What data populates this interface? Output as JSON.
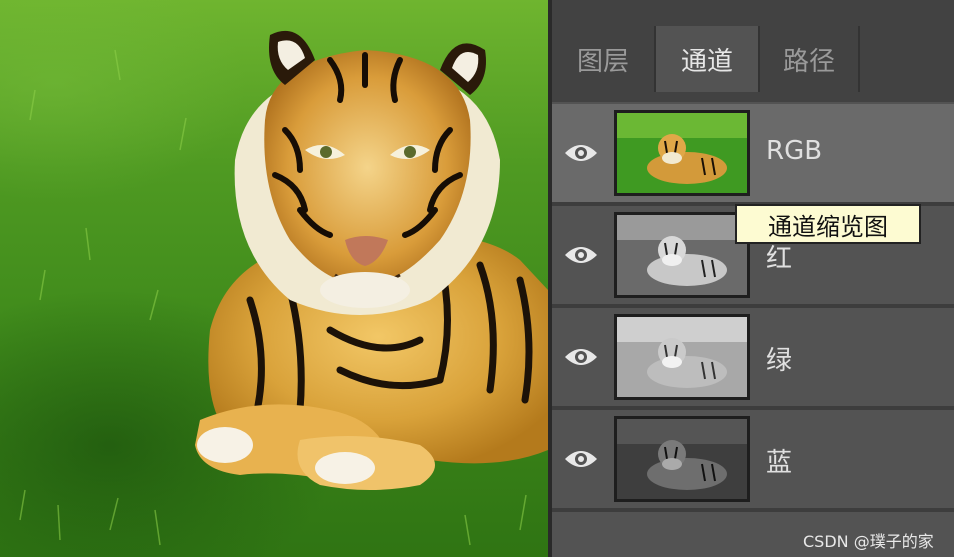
{
  "panel": {
    "tabs": [
      {
        "label": "图层",
        "active": false
      },
      {
        "label": "通道",
        "active": true
      },
      {
        "label": "路径",
        "active": false
      }
    ],
    "channels": [
      {
        "label": "RGB",
        "thumb": "color",
        "selected": true
      },
      {
        "label": "红",
        "thumb": "gray-dark",
        "selected": false
      },
      {
        "label": "绿",
        "thumb": "gray-light",
        "selected": false
      },
      {
        "label": "蓝",
        "thumb": "gray-darker",
        "selected": false
      }
    ]
  },
  "tooltip": "通道缩览图",
  "watermark": "CSDN @璞子的家",
  "icons": {
    "visibility": "eye-icon"
  },
  "colors": {
    "panel_bg": "#535353",
    "selected_row": "#6a6a6a",
    "tooltip_bg": "#fdfbd2"
  }
}
